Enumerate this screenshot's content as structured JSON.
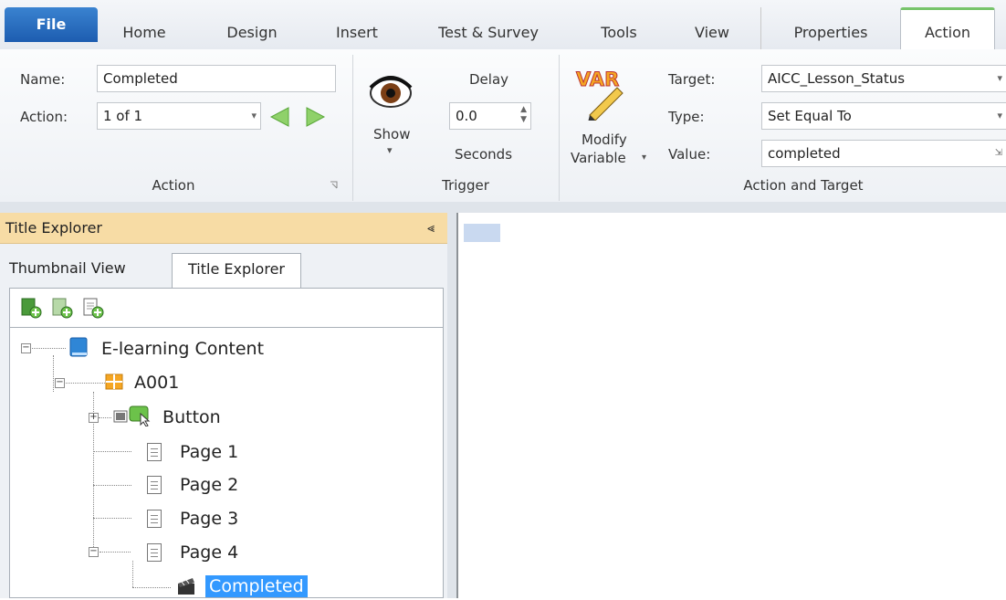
{
  "ribbon_tabs": [
    "File",
    "Home",
    "Design",
    "Insert",
    "Test & Survey",
    "Tools",
    "View",
    "Properties",
    "Action"
  ],
  "action_group": {
    "name_label": "Name:",
    "name_value": "Completed",
    "action_label": "Action:",
    "action_value": "1 of 1",
    "title": "Action"
  },
  "trigger_group": {
    "show_label": "Show",
    "delay_label": "Delay",
    "delay_value": "0.0",
    "seconds_label": "Seconds",
    "title": "Trigger"
  },
  "target_group": {
    "var_icon_text": "VAR",
    "modify_label_1": "Modify",
    "modify_label_2": "Variable",
    "target_label": "Target:",
    "target_value": "AICC_Lesson_Status",
    "type_label": "Type:",
    "type_value": "Set Equal To",
    "value_label": "Value:",
    "value_value": "completed",
    "title": "Action and Target"
  },
  "explorer": {
    "header": "Title Explorer",
    "pin": "⪡",
    "tab_thumbnail": "Thumbnail View",
    "tab_title_explorer": "Title Explorer",
    "tree": {
      "root": "E-learning Content",
      "chapter": "A001",
      "button": "Button",
      "page1": "Page 1",
      "page2": "Page 2",
      "page3": "Page 3",
      "page4": "Page 4",
      "completed": "Completed"
    }
  },
  "colors": {
    "accent_green": "#77c46a",
    "file_blue": "#2a6fc4",
    "selection": "#3399ff",
    "panel_header": "#f7dca5"
  }
}
